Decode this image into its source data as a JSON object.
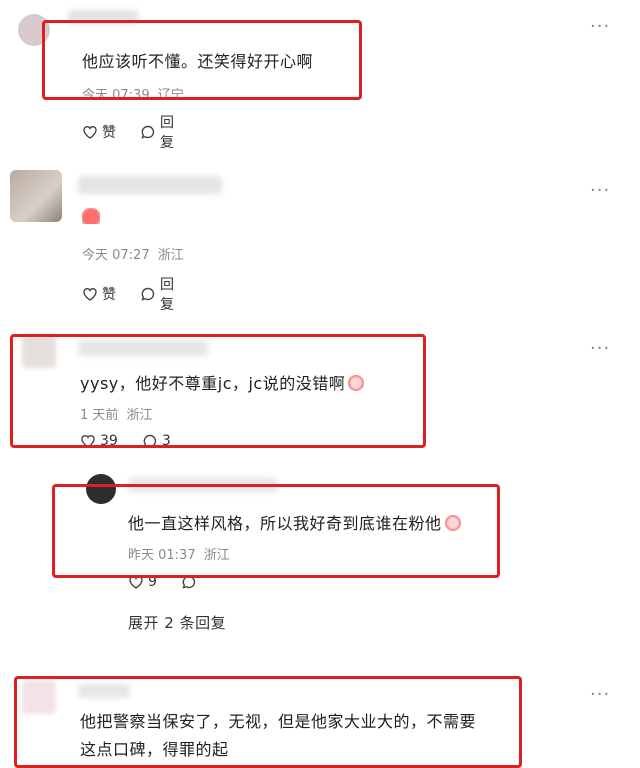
{
  "more_label": "···",
  "comments": [
    {
      "text": "他应该听不懂。还笑得好开心啊",
      "time": "今天 07:39",
      "location": "辽宁",
      "like_label": "赞",
      "reply_label": "回复"
    },
    {
      "text": "",
      "time": "今天 07:27",
      "location": "浙江",
      "like_label": "赞",
      "reply_label": "回复"
    },
    {
      "text": "yysy，他好不尊重jc，jc说的没错啊",
      "time": "1 天前",
      "location": "浙江",
      "like_count": "39",
      "reply_count": "3"
    },
    {
      "text": "他一直这样风格，所以我好奇到底谁在粉他",
      "time": "昨天 01:37",
      "location": "浙江",
      "like_count": "9"
    },
    {
      "text_line1": "他把警察当保安了，无视，但是他家大业大的，不需要",
      "text_line2": "这点口碑，得罪的起"
    }
  ],
  "expand_label": "展开 2 条回复",
  "colors": {
    "highlight": "#e02020",
    "meta": "#8a8a8a"
  }
}
